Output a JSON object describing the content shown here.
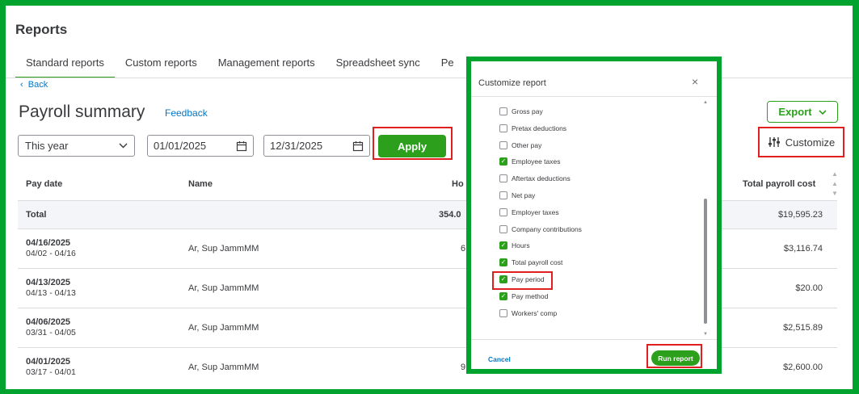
{
  "page": {
    "title": "Reports"
  },
  "tabs": [
    {
      "label": "Standard reports"
    },
    {
      "label": "Custom reports"
    },
    {
      "label": "Management reports"
    },
    {
      "label": "Spreadsheet sync"
    },
    {
      "label": "Pe"
    }
  ],
  "nav": {
    "back": "Back",
    "back_icon": "chevron-left-icon"
  },
  "report": {
    "title": "Payroll summary",
    "feedback": "Feedback"
  },
  "controls": {
    "period": "This year",
    "start_date": "01/01/2025",
    "end_date": "12/31/2025",
    "apply": "Apply",
    "export": "Export",
    "customize": "Customize"
  },
  "table": {
    "columns": {
      "pay_date": "Pay date",
      "name": "Name",
      "hours": "Ho",
      "total": "Total payroll cost"
    },
    "total_row": {
      "label": "Total",
      "hours": "354.0",
      "total": "$19,595.23"
    },
    "rows": [
      {
        "pay_date": "04/16/2025",
        "period": "04/02 - 04/16",
        "name": "Ar, Sup JammMM",
        "hours": "6",
        "total": "$3,116.74"
      },
      {
        "pay_date": "04/13/2025",
        "period": "04/13 - 04/13",
        "name": "Ar, Sup JammMM",
        "hours": "",
        "total": "$20.00"
      },
      {
        "pay_date": "04/06/2025",
        "period": "03/31 - 04/05",
        "name": "Ar, Sup JammMM",
        "hours": "",
        "total": "$2,515.89"
      },
      {
        "pay_date": "04/01/2025",
        "period": "03/17 - 04/01",
        "name": "Ar, Sup JammMM",
        "hours": "9",
        "total": "$2,600.00"
      }
    ]
  },
  "modal": {
    "title": "Customize report",
    "close": "×",
    "items": [
      {
        "label": "Gross pay",
        "checked": false
      },
      {
        "label": "Pretax deductions",
        "checked": false
      },
      {
        "label": "Other pay",
        "checked": false
      },
      {
        "label": "Employee taxes",
        "checked": true
      },
      {
        "label": "Aftertax deductions",
        "checked": false
      },
      {
        "label": "Net pay",
        "checked": false
      },
      {
        "label": "Employer taxes",
        "checked": false
      },
      {
        "label": "Company contributions",
        "checked": false
      },
      {
        "label": "Hours",
        "checked": true
      },
      {
        "label": "Total payroll cost",
        "checked": true
      },
      {
        "label": "Pay period",
        "checked": true
      },
      {
        "label": "Pay method",
        "checked": true
      },
      {
        "label": "Workers' comp",
        "checked": false
      }
    ],
    "cancel": "Cancel",
    "run": "Run report"
  },
  "colors": {
    "brand_green": "#2ca01c",
    "highlight_red": "#e02020",
    "frame_green": "#00a32e",
    "link_blue": "#0077c5"
  }
}
